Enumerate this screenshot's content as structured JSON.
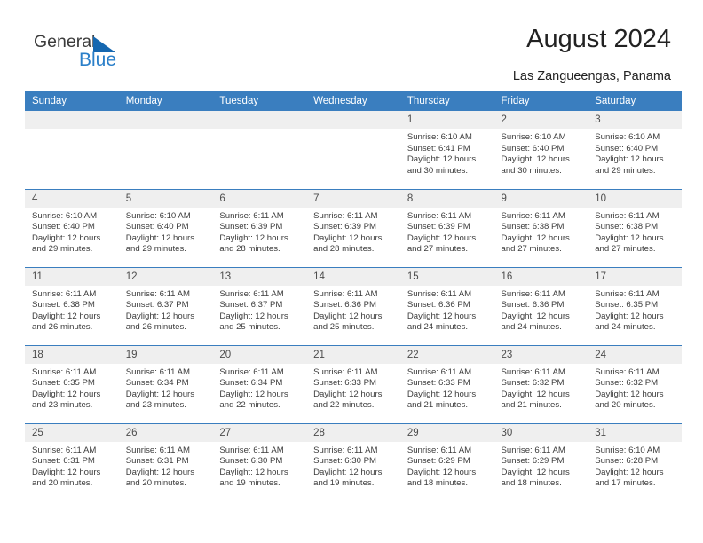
{
  "brand": {
    "name_top": "General",
    "name_bottom": "Blue",
    "triangle_color": "#1567b0",
    "blue_color": "#2a7fc9"
  },
  "header": {
    "title": "August 2024",
    "location": "Las Zangueengas, Panama"
  },
  "colors": {
    "header_row_bg": "#3a7ebf",
    "header_row_text": "#ffffff",
    "daynum_bg": "#efefef",
    "cell_bg": "#ffffff",
    "body_text": "#3c3c3c"
  },
  "weekday_headers": [
    "Sunday",
    "Monday",
    "Tuesday",
    "Wednesday",
    "Thursday",
    "Friday",
    "Saturday"
  ],
  "labels": {
    "sunrise_prefix": "Sunrise:",
    "sunset_prefix": "Sunset:",
    "daylight_prefix": "Daylight:"
  },
  "weeks": [
    [
      {
        "day": "",
        "blank": true
      },
      {
        "day": "",
        "blank": true
      },
      {
        "day": "",
        "blank": true
      },
      {
        "day": "",
        "blank": true
      },
      {
        "day": "1",
        "sunrise": "Sunrise: 6:10 AM",
        "sunset": "Sunset: 6:41 PM",
        "daylight_1": "Daylight: 12 hours",
        "daylight_2": "and 30 minutes."
      },
      {
        "day": "2",
        "sunrise": "Sunrise: 6:10 AM",
        "sunset": "Sunset: 6:40 PM",
        "daylight_1": "Daylight: 12 hours",
        "daylight_2": "and 30 minutes."
      },
      {
        "day": "3",
        "sunrise": "Sunrise: 6:10 AM",
        "sunset": "Sunset: 6:40 PM",
        "daylight_1": "Daylight: 12 hours",
        "daylight_2": "and 29 minutes."
      }
    ],
    [
      {
        "day": "4",
        "sunrise": "Sunrise: 6:10 AM",
        "sunset": "Sunset: 6:40 PM",
        "daylight_1": "Daylight: 12 hours",
        "daylight_2": "and 29 minutes."
      },
      {
        "day": "5",
        "sunrise": "Sunrise: 6:10 AM",
        "sunset": "Sunset: 6:40 PM",
        "daylight_1": "Daylight: 12 hours",
        "daylight_2": "and 29 minutes."
      },
      {
        "day": "6",
        "sunrise": "Sunrise: 6:11 AM",
        "sunset": "Sunset: 6:39 PM",
        "daylight_1": "Daylight: 12 hours",
        "daylight_2": "and 28 minutes."
      },
      {
        "day": "7",
        "sunrise": "Sunrise: 6:11 AM",
        "sunset": "Sunset: 6:39 PM",
        "daylight_1": "Daylight: 12 hours",
        "daylight_2": "and 28 minutes."
      },
      {
        "day": "8",
        "sunrise": "Sunrise: 6:11 AM",
        "sunset": "Sunset: 6:39 PM",
        "daylight_1": "Daylight: 12 hours",
        "daylight_2": "and 27 minutes."
      },
      {
        "day": "9",
        "sunrise": "Sunrise: 6:11 AM",
        "sunset": "Sunset: 6:38 PM",
        "daylight_1": "Daylight: 12 hours",
        "daylight_2": "and 27 minutes."
      },
      {
        "day": "10",
        "sunrise": "Sunrise: 6:11 AM",
        "sunset": "Sunset: 6:38 PM",
        "daylight_1": "Daylight: 12 hours",
        "daylight_2": "and 27 minutes."
      }
    ],
    [
      {
        "day": "11",
        "sunrise": "Sunrise: 6:11 AM",
        "sunset": "Sunset: 6:38 PM",
        "daylight_1": "Daylight: 12 hours",
        "daylight_2": "and 26 minutes."
      },
      {
        "day": "12",
        "sunrise": "Sunrise: 6:11 AM",
        "sunset": "Sunset: 6:37 PM",
        "daylight_1": "Daylight: 12 hours",
        "daylight_2": "and 26 minutes."
      },
      {
        "day": "13",
        "sunrise": "Sunrise: 6:11 AM",
        "sunset": "Sunset: 6:37 PM",
        "daylight_1": "Daylight: 12 hours",
        "daylight_2": "and 25 minutes."
      },
      {
        "day": "14",
        "sunrise": "Sunrise: 6:11 AM",
        "sunset": "Sunset: 6:36 PM",
        "daylight_1": "Daylight: 12 hours",
        "daylight_2": "and 25 minutes."
      },
      {
        "day": "15",
        "sunrise": "Sunrise: 6:11 AM",
        "sunset": "Sunset: 6:36 PM",
        "daylight_1": "Daylight: 12 hours",
        "daylight_2": "and 24 minutes."
      },
      {
        "day": "16",
        "sunrise": "Sunrise: 6:11 AM",
        "sunset": "Sunset: 6:36 PM",
        "daylight_1": "Daylight: 12 hours",
        "daylight_2": "and 24 minutes."
      },
      {
        "day": "17",
        "sunrise": "Sunrise: 6:11 AM",
        "sunset": "Sunset: 6:35 PM",
        "daylight_1": "Daylight: 12 hours",
        "daylight_2": "and 24 minutes."
      }
    ],
    [
      {
        "day": "18",
        "sunrise": "Sunrise: 6:11 AM",
        "sunset": "Sunset: 6:35 PM",
        "daylight_1": "Daylight: 12 hours",
        "daylight_2": "and 23 minutes."
      },
      {
        "day": "19",
        "sunrise": "Sunrise: 6:11 AM",
        "sunset": "Sunset: 6:34 PM",
        "daylight_1": "Daylight: 12 hours",
        "daylight_2": "and 23 minutes."
      },
      {
        "day": "20",
        "sunrise": "Sunrise: 6:11 AM",
        "sunset": "Sunset: 6:34 PM",
        "daylight_1": "Daylight: 12 hours",
        "daylight_2": "and 22 minutes."
      },
      {
        "day": "21",
        "sunrise": "Sunrise: 6:11 AM",
        "sunset": "Sunset: 6:33 PM",
        "daylight_1": "Daylight: 12 hours",
        "daylight_2": "and 22 minutes."
      },
      {
        "day": "22",
        "sunrise": "Sunrise: 6:11 AM",
        "sunset": "Sunset: 6:33 PM",
        "daylight_1": "Daylight: 12 hours",
        "daylight_2": "and 21 minutes."
      },
      {
        "day": "23",
        "sunrise": "Sunrise: 6:11 AM",
        "sunset": "Sunset: 6:32 PM",
        "daylight_1": "Daylight: 12 hours",
        "daylight_2": "and 21 minutes."
      },
      {
        "day": "24",
        "sunrise": "Sunrise: 6:11 AM",
        "sunset": "Sunset: 6:32 PM",
        "daylight_1": "Daylight: 12 hours",
        "daylight_2": "and 20 minutes."
      }
    ],
    [
      {
        "day": "25",
        "sunrise": "Sunrise: 6:11 AM",
        "sunset": "Sunset: 6:31 PM",
        "daylight_1": "Daylight: 12 hours",
        "daylight_2": "and 20 minutes."
      },
      {
        "day": "26",
        "sunrise": "Sunrise: 6:11 AM",
        "sunset": "Sunset: 6:31 PM",
        "daylight_1": "Daylight: 12 hours",
        "daylight_2": "and 20 minutes."
      },
      {
        "day": "27",
        "sunrise": "Sunrise: 6:11 AM",
        "sunset": "Sunset: 6:30 PM",
        "daylight_1": "Daylight: 12 hours",
        "daylight_2": "and 19 minutes."
      },
      {
        "day": "28",
        "sunrise": "Sunrise: 6:11 AM",
        "sunset": "Sunset: 6:30 PM",
        "daylight_1": "Daylight: 12 hours",
        "daylight_2": "and 19 minutes."
      },
      {
        "day": "29",
        "sunrise": "Sunrise: 6:11 AM",
        "sunset": "Sunset: 6:29 PM",
        "daylight_1": "Daylight: 12 hours",
        "daylight_2": "and 18 minutes."
      },
      {
        "day": "30",
        "sunrise": "Sunrise: 6:11 AM",
        "sunset": "Sunset: 6:29 PM",
        "daylight_1": "Daylight: 12 hours",
        "daylight_2": "and 18 minutes."
      },
      {
        "day": "31",
        "sunrise": "Sunrise: 6:10 AM",
        "sunset": "Sunset: 6:28 PM",
        "daylight_1": "Daylight: 12 hours",
        "daylight_2": "and 17 minutes."
      }
    ]
  ]
}
